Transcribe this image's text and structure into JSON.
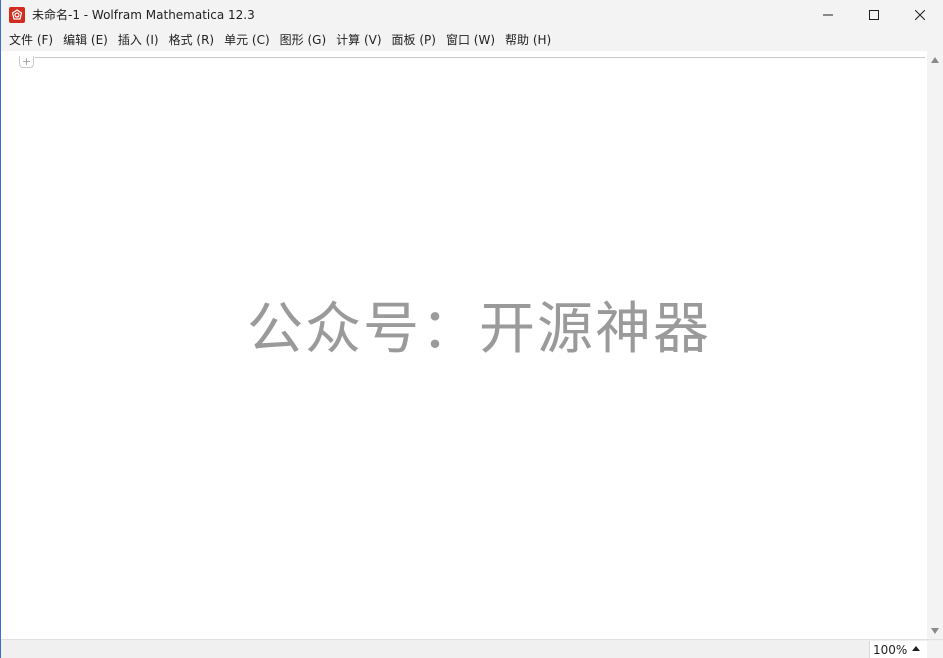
{
  "window": {
    "title": "未命名-1 - Wolfram Mathematica 12.3",
    "app_icon": "mathematica-spikey-icon",
    "accent_color": "#d42b1f",
    "controls": {
      "minimize_icon": "minimize-icon",
      "maximize_icon": "maximize-icon",
      "close_icon": "close-icon"
    }
  },
  "menubar": {
    "items": [
      {
        "label": "文件 (F)"
      },
      {
        "label": "编辑 (E)"
      },
      {
        "label": "插入 (I)"
      },
      {
        "label": "格式 (R)"
      },
      {
        "label": "单元 (C)"
      },
      {
        "label": "图形 (G)"
      },
      {
        "label": "计算 (V)"
      },
      {
        "label": "面板 (P)"
      },
      {
        "label": "窗口 (W)"
      },
      {
        "label": "帮助 (H)"
      }
    ]
  },
  "notebook": {
    "cell_insert_symbol": "+",
    "watermark": "公众号：开源神器"
  },
  "statusbar": {
    "zoom": "100%"
  }
}
